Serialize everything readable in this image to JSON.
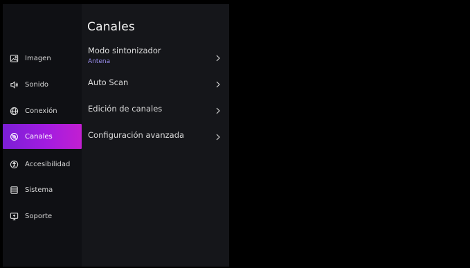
{
  "sidebar": {
    "items": [
      {
        "label": "Imagen",
        "icon": "image-icon",
        "active": false
      },
      {
        "label": "Sonido",
        "icon": "speaker-icon",
        "active": false
      },
      {
        "label": "Conexión",
        "icon": "globe-icon",
        "active": false
      },
      {
        "label": "Canales",
        "icon": "channels-icon",
        "active": true
      },
      {
        "label": "Accesibilidad",
        "icon": "accessibility-icon",
        "active": false
      },
      {
        "label": "Sistema",
        "icon": "system-icon",
        "active": false
      },
      {
        "label": "Soporte",
        "icon": "support-icon",
        "active": false
      }
    ]
  },
  "panel": {
    "title": "Canales",
    "items": [
      {
        "label": "Modo sintonizador",
        "value": "Antena"
      },
      {
        "label": "Auto Scan"
      },
      {
        "label": "Edición de canales"
      },
      {
        "label": "Configuración avanzada"
      }
    ]
  },
  "colors": {
    "accent_start": "#7b1fd6",
    "accent_end": "#c21fd1",
    "value_text": "#9b8ff0"
  }
}
